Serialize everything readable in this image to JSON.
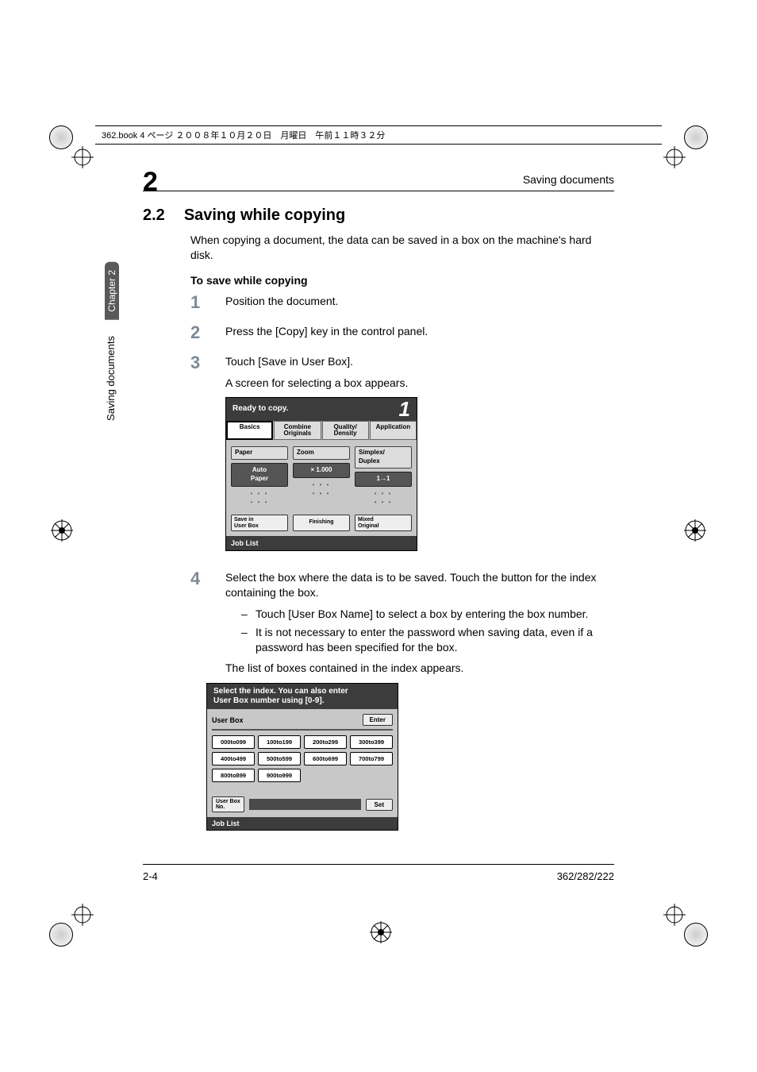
{
  "header_note": "362.book  4 ページ  ２００８年１０月２０日　月曜日　午前１１時３２分",
  "chapter_number": "2",
  "breadcrumb": "Saving documents",
  "section_number": "2.2",
  "section_title": "Saving while copying",
  "intro": "When copying a document, the data can be saved in a box on the machine's hard disk.",
  "subheading": "To save while copying",
  "side": {
    "tab": "Chapter 2",
    "text": "Saving documents"
  },
  "steps": {
    "s1": {
      "num": "1",
      "text": "Position the document."
    },
    "s2": {
      "num": "2",
      "text": "Press the [Copy] key in the control panel."
    },
    "s3": {
      "num": "3",
      "text": "Touch [Save in User Box].",
      "sub": "A screen for selecting a box appears."
    },
    "s4": {
      "num": "4",
      "text": "Select the box where the data is to be saved. Touch the button for the index containing the box.",
      "bullets": [
        "Touch [User Box Name] to select a box by entering the box number.",
        "It is not necessary to enter the password when saving data, even if a password has been specified for the box."
      ],
      "after": "The list of boxes contained in the index appears."
    }
  },
  "panel1": {
    "title": "Ready to copy.",
    "big": "1",
    "tabs": {
      "basics": "Basics",
      "combine_l1": "Combine",
      "combine_l2": "Originals",
      "quality_l1": "Quality/",
      "quality_l2": "Density",
      "application": "Application"
    },
    "cols": {
      "paper": "Paper",
      "auto_l1": "Auto",
      "auto_l2": "Paper",
      "zoom": "Zoom",
      "zoom_val": "× 1.000",
      "sd_l1": "Simplex/",
      "sd_l2": "Duplex",
      "sd_val": "1→1"
    },
    "bottom": {
      "save_l1": "Save in",
      "save_l2": "User Box",
      "finishing": "Finishing",
      "mixed_l1": "Mixed",
      "mixed_l2": "Original"
    },
    "footer": "Job List"
  },
  "panel2": {
    "title_l1": "Select the index. You can also enter",
    "title_l2": "User Box number using [0-9].",
    "user_box": "User Box",
    "enter": "Enter",
    "cells": [
      "000to099",
      "100to199",
      "200to299",
      "300to399",
      "400to499",
      "500to599",
      "600to699",
      "700to799",
      "800to899",
      "900to999"
    ],
    "ubno_l1": "User Box",
    "ubno_l2": "No.",
    "set": "Set",
    "footer": "Job List"
  },
  "footer": {
    "left": "2-4",
    "right": "362/282/222"
  }
}
